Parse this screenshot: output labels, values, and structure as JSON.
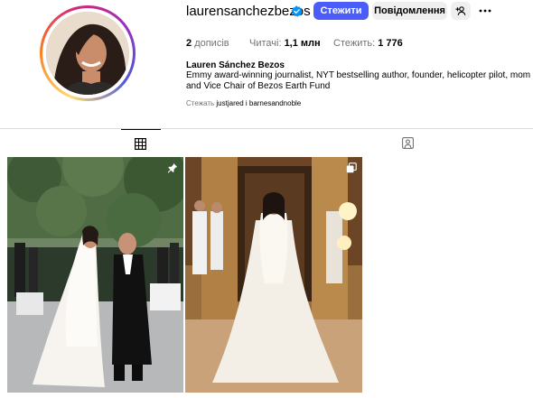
{
  "profile": {
    "username": "laurensanchezbezos",
    "follow_label": "Стежити",
    "message_label": "Повідомлення",
    "full_name": "Lauren Sánchez Bezos",
    "bio": "Emmy award-winning journalist, NYT bestselling author, founder, helicopter pilot, mom and Vice Chair of Bezos Earth Fund"
  },
  "stats": {
    "posts_count": "2",
    "posts_label": "дописів",
    "followers_label": "Читачі:",
    "followers_count": "1,1 млн",
    "following_label": "Стежить:",
    "following_count": "1 776"
  },
  "followed_by": {
    "prefix": "Стежать",
    "names": "justjared і barnesandnoble"
  },
  "tabs": {
    "posts_icon": "grid-icon",
    "tagged_icon": "tagged-icon",
    "active": "posts"
  },
  "posts": [
    {
      "id": "post-1",
      "badge": "pin-icon",
      "subject": "wedding-couple-garden"
    },
    {
      "id": "post-2",
      "badge": "carousel-icon",
      "subject": "bride-in-gown-indoors"
    }
  ],
  "colors": {
    "accent": "#4a5df9",
    "secondary_button": "#efefef",
    "muted_text": "#737373",
    "verified_blue": "#0095f6"
  }
}
